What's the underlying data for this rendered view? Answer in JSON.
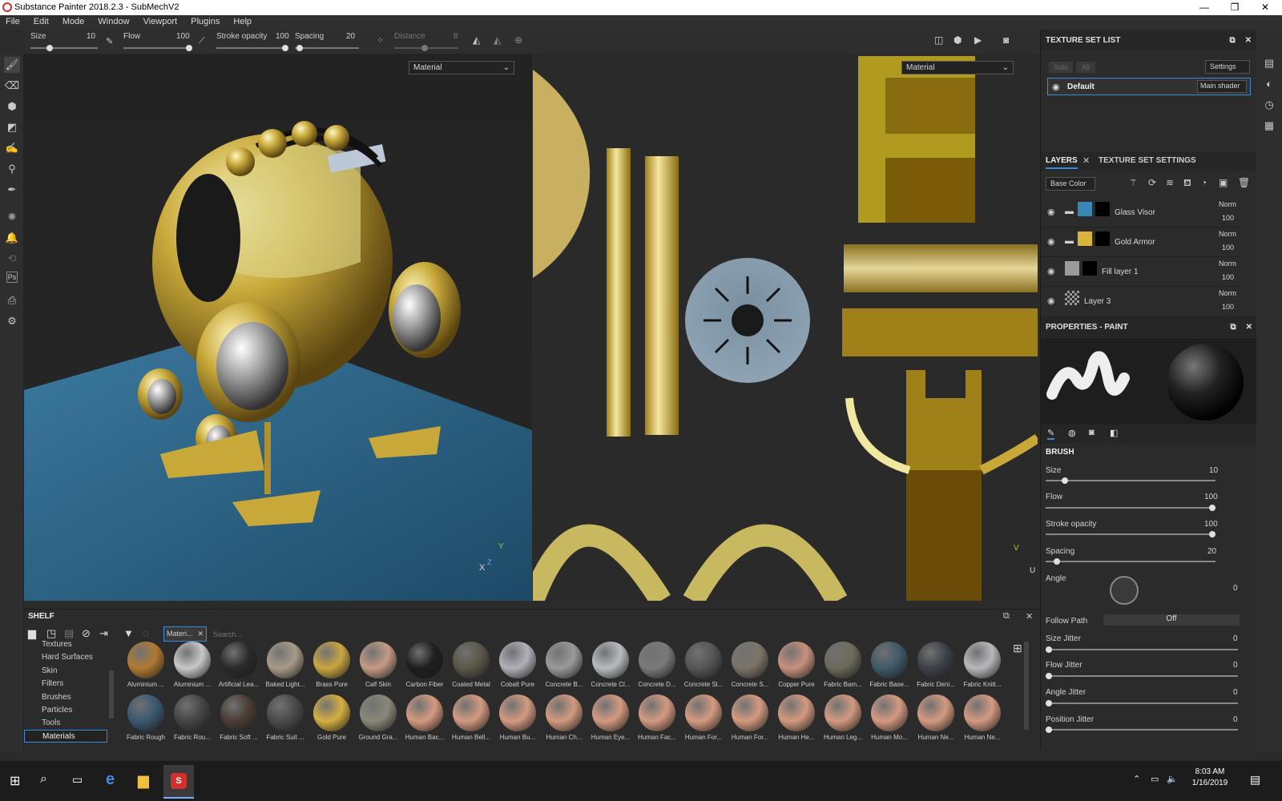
{
  "window": {
    "title": "Substance Painter 2018.2.3 - SubMechV2",
    "minimize": "—",
    "maximize": "❐",
    "close": "✕"
  },
  "menu": [
    "File",
    "Edit",
    "Mode",
    "Window",
    "Viewport",
    "Plugins",
    "Help"
  ],
  "tool_options": {
    "size_label": "Size",
    "size_value": "10",
    "flow_label": "Flow",
    "flow_value": "100",
    "stroke_label": "Stroke opacity",
    "stroke_value": "100",
    "spacing_label": "Spacing",
    "spacing_value": "20",
    "distance_label": "Distance",
    "distance_value": "8"
  },
  "viewport": {
    "left_mode": "Material",
    "right_mode": "Material",
    "axis_y": "Y",
    "axis_x": "X",
    "axis_z": "Z",
    "uv_v": "V",
    "uv_u": "U"
  },
  "texture_set_list": {
    "title": "TEXTURE SET LIST",
    "solo": "Solo",
    "all": "All",
    "settings": "Settings",
    "set_name": "Default",
    "shader": "Main shader"
  },
  "layers_panel": {
    "tab_layers": "LAYERS",
    "tab_tss": "TEXTURE SET SETTINGS",
    "channel": "Base Color",
    "layers": [
      {
        "name": "Glass Visor",
        "blend": "Norm",
        "opacity": "100",
        "color": "#3a86b4"
      },
      {
        "name": "Gold Armor",
        "blend": "Norm",
        "opacity": "100",
        "color": "#d8b43a"
      },
      {
        "name": "Fill layer 1",
        "blend": "Norm",
        "opacity": "100",
        "color": "#9a9a9a"
      },
      {
        "name": "Layer 3",
        "blend": "Norm",
        "opacity": "100",
        "color": "#cccccc"
      }
    ]
  },
  "properties": {
    "title": "PROPERTIES - PAINT",
    "section": "BRUSH",
    "size_label": "Size",
    "size_value": "10",
    "size_level": 0.1,
    "flow_label": "Flow",
    "flow_value": "100",
    "flow_level": 1.0,
    "stroke_label": "Stroke opacity",
    "stroke_value": "100",
    "stroke_level": 1.0,
    "spacing_label": "Spacing",
    "spacing_value": "20",
    "spacing_level": 0.05,
    "angle_label": "Angle",
    "angle_value": "0",
    "follow_path_label": "Follow Path",
    "follow_path_value": "Off",
    "size_jitter_label": "Size Jitter",
    "size_jitter_value": "0",
    "flow_jitter_label": "Flow Jitter",
    "flow_jitter_value": "0",
    "angle_jitter_label": "Angle Jitter",
    "angle_jitter_value": "0",
    "position_jitter_label": "Position Jitter",
    "position_jitter_value": "0"
  },
  "shelf": {
    "title": "SHELF",
    "filter_tag": "Materi...",
    "search_placeholder": "Search...",
    "categories": [
      "Textures",
      "Hard Surfaces",
      "Skin",
      "Filters",
      "Brushes",
      "Particles",
      "Tools",
      "Materials"
    ],
    "selected_category": "Materials",
    "materials": [
      {
        "name": "Aluminium ...",
        "color": "#b07a30"
      },
      {
        "name": "Aluminium ...",
        "color": "#c8c8c8"
      },
      {
        "name": "Artificial Lea...",
        "color": "#2a2a2a"
      },
      {
        "name": "Baked Light...",
        "color": "#a89a88"
      },
      {
        "name": "Brass Pure",
        "color": "#c9a640"
      },
      {
        "name": "Calf Skin",
        "color": "#c49a84"
      },
      {
        "name": "Carbon Fiber",
        "color": "#1e1e1e"
      },
      {
        "name": "Coated Metal",
        "color": "#5a5648"
      },
      {
        "name": "Cobalt Pure",
        "color": "#b0b0b8"
      },
      {
        "name": "Concrete B...",
        "color": "#9a9a9a"
      },
      {
        "name": "Concrete Cl...",
        "color": "#b8bcc0"
      },
      {
        "name": "Concrete D...",
        "color": "#7a7a7a"
      },
      {
        "name": "Concrete Sl...",
        "color": "#555555"
      },
      {
        "name": "Concrete S...",
        "color": "#7c7468"
      },
      {
        "name": "Copper Pure",
        "color": "#c8907c"
      },
      {
        "name": "Fabric Bam...",
        "color": "#6c6a5a"
      },
      {
        "name": "Fabric Base...",
        "color": "#3e5a68"
      },
      {
        "name": "Fabric Deni...",
        "color": "#3c4048"
      },
      {
        "name": "Fabric Knitt...",
        "color": "#b8b8bc"
      },
      {
        "name": "Fabric Rough",
        "color": "#3a5870"
      },
      {
        "name": "Fabric Rou...",
        "color": "#444444"
      },
      {
        "name": "Fabric Soft ...",
        "color": "#4a3c34"
      },
      {
        "name": "Fabric Suit ...",
        "color": "#4a4a4a"
      },
      {
        "name": "Gold Pure",
        "color": "#d4b040"
      },
      {
        "name": "Ground Gra...",
        "color": "#8a8878"
      },
      {
        "name": "Human Bac...",
        "color": "#d49a80"
      },
      {
        "name": "Human Bell...",
        "color": "#d49a80"
      },
      {
        "name": "Human Bu...",
        "color": "#d49a80"
      },
      {
        "name": "Human Ch...",
        "color": "#d49a80"
      },
      {
        "name": "Human Eye...",
        "color": "#d49a80"
      },
      {
        "name": "Human Fac...",
        "color": "#d49a80"
      },
      {
        "name": "Human For...",
        "color": "#d49a80"
      },
      {
        "name": "Human For...",
        "color": "#d49a80"
      },
      {
        "name": "Human He...",
        "color": "#d49a80"
      },
      {
        "name": "Human Leg...",
        "color": "#d49a80"
      },
      {
        "name": "Human Mo...",
        "color": "#d49a80"
      },
      {
        "name": "Human Ne...",
        "color": "#d49a80"
      },
      {
        "name": "Human Ne...",
        "color": "#d49a80"
      }
    ]
  },
  "taskbar": {
    "time": "8:03 AM",
    "date": "1/16/2019"
  }
}
